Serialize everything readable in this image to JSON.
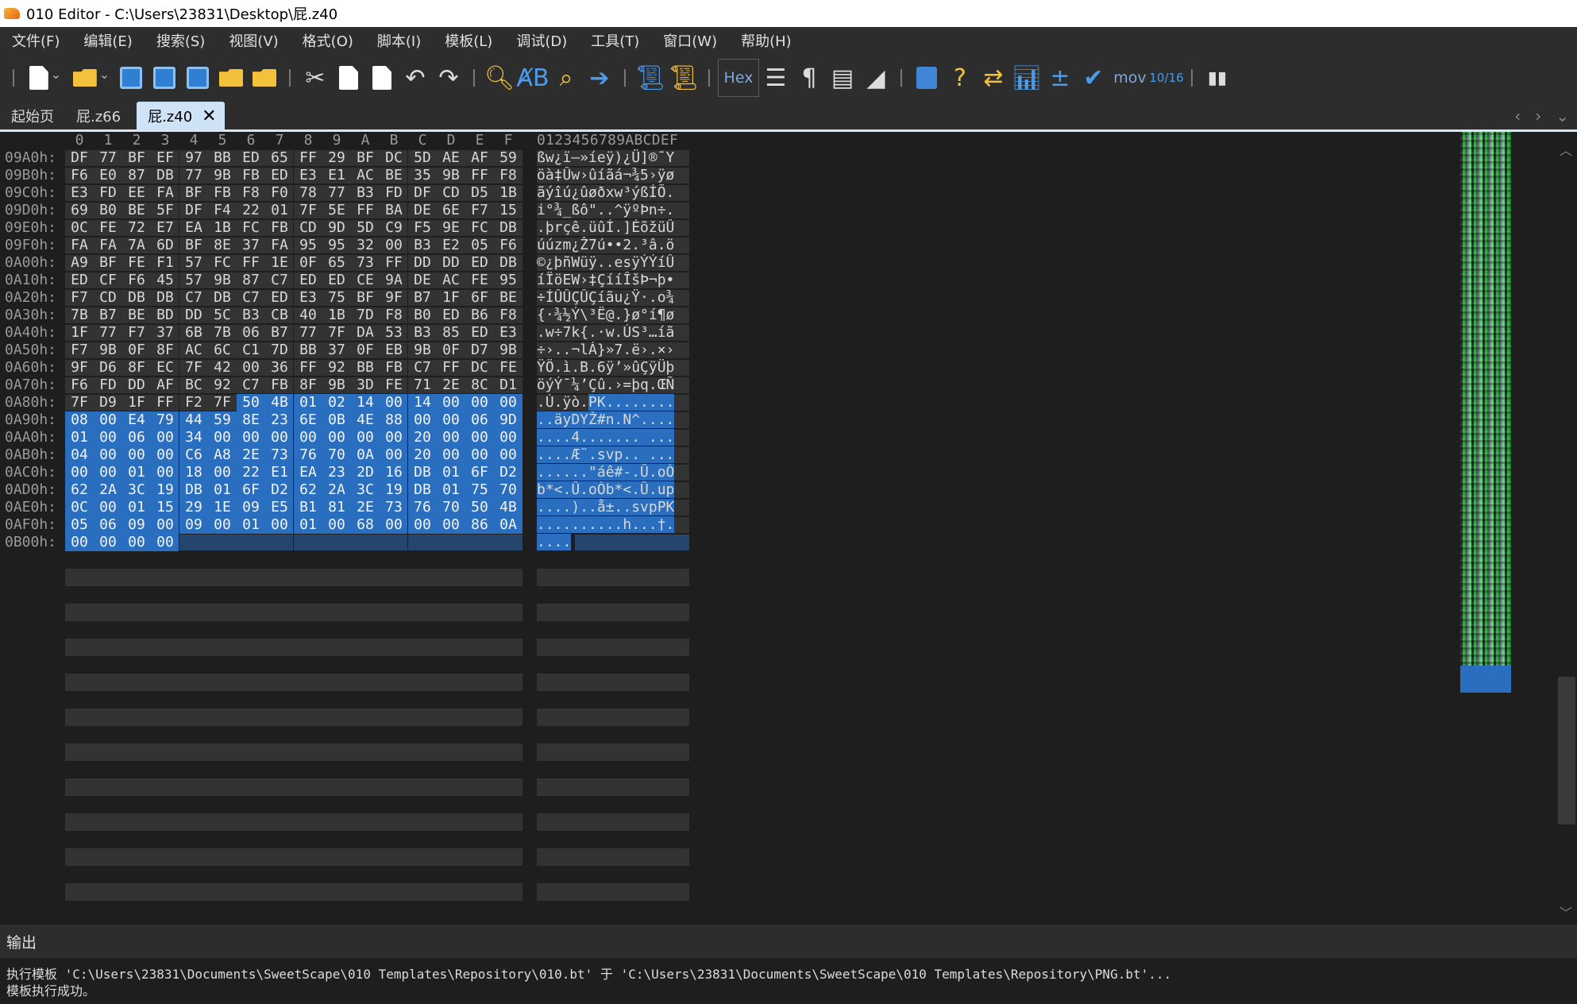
{
  "window": {
    "title": "010 Editor - C:\\Users\\23831\\Desktop\\屁.z40"
  },
  "menu": [
    "文件(F)",
    "编辑(E)",
    "搜索(S)",
    "视图(V)",
    "格式(O)",
    "脚本(I)",
    "模板(L)",
    "调试(D)",
    "工具(T)",
    "窗口(W)",
    "帮助(H)"
  ],
  "toolbar": {
    "hex_label": "Hex",
    "mov_label": "mov",
    "convert_label": "10/16"
  },
  "tabs": [
    {
      "label": "起始页",
      "active": false
    },
    {
      "label": "屁.z66",
      "active": false
    },
    {
      "label": "屁.z40",
      "active": true
    }
  ],
  "editor": {
    "hex_columns": [
      "0",
      "1",
      "2",
      "3",
      "4",
      "5",
      "6",
      "7",
      "8",
      "9",
      "A",
      "B",
      "C",
      "D",
      "E",
      "F"
    ],
    "char_header": "0123456789ABCDEF",
    "rows": [
      {
        "addr": "09A0h:",
        "bytes": [
          "DF",
          "77",
          "BF",
          "EF",
          "97",
          "BB",
          "ED",
          "65",
          "FF",
          "29",
          "BF",
          "DC",
          "5D",
          "AE",
          "AF",
          "59"
        ],
        "chars": "ßw¿ï—»íeÿ)¿Ü]®¯Y",
        "sel_start": 16
      },
      {
        "addr": "09B0h:",
        "bytes": [
          "F6",
          "E0",
          "87",
          "DB",
          "77",
          "9B",
          "FB",
          "ED",
          "E3",
          "E1",
          "AC",
          "BE",
          "35",
          "9B",
          "FF",
          "F8"
        ],
        "chars": "öà‡Ûw›ûíãá¬¾5›ÿø",
        "sel_start": 16
      },
      {
        "addr": "09C0h:",
        "bytes": [
          "E3",
          "FD",
          "EE",
          "FA",
          "BF",
          "FB",
          "F8",
          "F0",
          "78",
          "77",
          "B3",
          "FD",
          "DF",
          "CD",
          "D5",
          "1B"
        ],
        "chars": "ãýîú¿ûøðxw³ýßÍÕ.",
        "sel_start": 16
      },
      {
        "addr": "09D0h:",
        "bytes": [
          "69",
          "B0",
          "BE",
          "5F",
          "DF",
          "F4",
          "22",
          "01",
          "7F",
          "5E",
          "FF",
          "BA",
          "DE",
          "6E",
          "F7",
          "15"
        ],
        "chars": "i°¾_ßô\"..^ÿºÞn÷.",
        "sel_start": 16
      },
      {
        "addr": "09E0h:",
        "bytes": [
          "0C",
          "FE",
          "72",
          "E7",
          "EA",
          "1B",
          "FC",
          "FB",
          "CD",
          "9D",
          "5D",
          "C9",
          "F5",
          "9E",
          "FC",
          "DB"
        ],
        "chars": ".þrçê.üûÍ.]ÉõžüÛ",
        "sel_start": 16
      },
      {
        "addr": "09F0h:",
        "bytes": [
          "FA",
          "FA",
          "7A",
          "6D",
          "BF",
          "8E",
          "37",
          "FA",
          "95",
          "95",
          "32",
          "00",
          "B3",
          "E2",
          "05",
          "F6"
        ],
        "chars": "úúzm¿Ž7ú••2.³â.ö",
        "sel_start": 16
      },
      {
        "addr": "0A00h:",
        "bytes": [
          "A9",
          "BF",
          "FE",
          "F1",
          "57",
          "FC",
          "FF",
          "1E",
          "0F",
          "65",
          "73",
          "FF",
          "DD",
          "DD",
          "ED",
          "DB"
        ],
        "chars": "©¿þñWüÿ..esÿÝÝíÛ",
        "sel_start": 16
      },
      {
        "addr": "0A10h:",
        "bytes": [
          "ED",
          "CF",
          "F6",
          "45",
          "57",
          "9B",
          "87",
          "C7",
          "ED",
          "ED",
          "CE",
          "9A",
          "DE",
          "AC",
          "FE",
          "95"
        ],
        "chars": "íÏöEW›‡ÇííÎšÞ¬þ•",
        "sel_start": 16
      },
      {
        "addr": "0A20h:",
        "bytes": [
          "F7",
          "CD",
          "DB",
          "DB",
          "C7",
          "DB",
          "C7",
          "ED",
          "E3",
          "75",
          "BF",
          "9F",
          "B7",
          "1F",
          "6F",
          "BE"
        ],
        "chars": "÷ÍÛÛÇÛÇíãu¿Ÿ·.o¾",
        "sel_start": 16
      },
      {
        "addr": "0A30h:",
        "bytes": [
          "7B",
          "B7",
          "BE",
          "BD",
          "DD",
          "5C",
          "B3",
          "CB",
          "40",
          "1B",
          "7D",
          "F8",
          "B0",
          "ED",
          "B6",
          "F8"
        ],
        "chars": "{·¾½Ý\\³Ë@.}ø°í¶ø",
        "sel_start": 16
      },
      {
        "addr": "0A40h:",
        "bytes": [
          "1F",
          "77",
          "F7",
          "37",
          "6B",
          "7B",
          "06",
          "B7",
          "77",
          "7F",
          "DA",
          "53",
          "B3",
          "85",
          "ED",
          "E3"
        ],
        "chars": ".w÷7k{.·w.ÚS³…íã",
        "sel_start": 16
      },
      {
        "addr": "0A50h:",
        "bytes": [
          "F7",
          "9B",
          "0F",
          "8F",
          "AC",
          "6C",
          "C1",
          "7D",
          "BB",
          "37",
          "0F",
          "EB",
          "9B",
          "0F",
          "D7",
          "9B"
        ],
        "chars": "÷›..¬lÁ}»7.ë›.×›",
        "sel_start": 16
      },
      {
        "addr": "0A60h:",
        "bytes": [
          "9F",
          "D6",
          "8F",
          "EC",
          "7F",
          "42",
          "00",
          "36",
          "FF",
          "92",
          "BB",
          "FB",
          "C7",
          "FF",
          "DC",
          "FE"
        ],
        "chars": "ŸÖ.ì.B.6ÿ’»ûÇÿÜþ",
        "sel_start": 16
      },
      {
        "addr": "0A70h:",
        "bytes": [
          "F6",
          "FD",
          "DD",
          "AF",
          "BC",
          "92",
          "C7",
          "FB",
          "8F",
          "9B",
          "3D",
          "FE",
          "71",
          "2E",
          "8C",
          "D1"
        ],
        "chars": "öýÝ¯¼’Çû.›=þq.ŒÑ",
        "sel_start": 16
      },
      {
        "addr": "0A80h:",
        "bytes": [
          "7F",
          "D9",
          "1F",
          "FF",
          "F2",
          "7F",
          "50",
          "4B",
          "01",
          "02",
          "14",
          "00",
          "14",
          "00",
          "00",
          "00"
        ],
        "chars": ".Ù.ÿò.PK........",
        "sel_start": 6
      },
      {
        "addr": "0A90h:",
        "bytes": [
          "08",
          "00",
          "E4",
          "79",
          "44",
          "59",
          "8E",
          "23",
          "6E",
          "0B",
          "4E",
          "88",
          "00",
          "00",
          "06",
          "9D"
        ],
        "chars": "..äyDYŽ#n.N^....",
        "sel_start": 0
      },
      {
        "addr": "0AA0h:",
        "bytes": [
          "01",
          "00",
          "06",
          "00",
          "34",
          "00",
          "00",
          "00",
          "00",
          "00",
          "00",
          "00",
          "20",
          "00",
          "00",
          "00"
        ],
        "chars": "....4....... ...",
        "sel_start": 0
      },
      {
        "addr": "0AB0h:",
        "bytes": [
          "04",
          "00",
          "00",
          "00",
          "C6",
          "A8",
          "2E",
          "73",
          "76",
          "70",
          "0A",
          "00",
          "20",
          "00",
          "00",
          "00"
        ],
        "chars": "....Æ¨.svp.. ...",
        "sel_start": 0
      },
      {
        "addr": "0AC0h:",
        "bytes": [
          "00",
          "00",
          "01",
          "00",
          "18",
          "00",
          "22",
          "E1",
          "EA",
          "23",
          "2D",
          "16",
          "DB",
          "01",
          "6F",
          "D2"
        ],
        "chars": "......\"áê#-.Û.oÒ",
        "sel_start": 0
      },
      {
        "addr": "0AD0h:",
        "bytes": [
          "62",
          "2A",
          "3C",
          "19",
          "DB",
          "01",
          "6F",
          "D2",
          "62",
          "2A",
          "3C",
          "19",
          "DB",
          "01",
          "75",
          "70"
        ],
        "chars": "b*<.Û.oÒb*<.Û.up",
        "sel_start": 0
      },
      {
        "addr": "0AE0h:",
        "bytes": [
          "0C",
          "00",
          "01",
          "15",
          "29",
          "1E",
          "09",
          "E5",
          "B1",
          "81",
          "2E",
          "73",
          "76",
          "70",
          "50",
          "4B"
        ],
        "chars": "....)..å±..svpPK",
        "sel_start": 0
      },
      {
        "addr": "0AF0h:",
        "bytes": [
          "05",
          "06",
          "09",
          "00",
          "09",
          "00",
          "01",
          "00",
          "01",
          "00",
          "68",
          "00",
          "00",
          "00",
          "86",
          "0A"
        ],
        "chars": "..........h...†.",
        "sel_start": 0
      },
      {
        "addr": "0B00h:",
        "bytes": [
          "00",
          "00",
          "00",
          "00"
        ],
        "chars": "....",
        "sel_start": 0
      }
    ]
  },
  "output": {
    "title": "输出",
    "lines": [
      "执行模板 'C:\\Users\\23831\\Documents\\SweetScape\\010 Templates\\Repository\\010.bt' 于 'C:\\Users\\23831\\Documents\\SweetScape\\010 Templates\\Repository\\PNG.bt'...",
      "模板执行成功。"
    ]
  }
}
